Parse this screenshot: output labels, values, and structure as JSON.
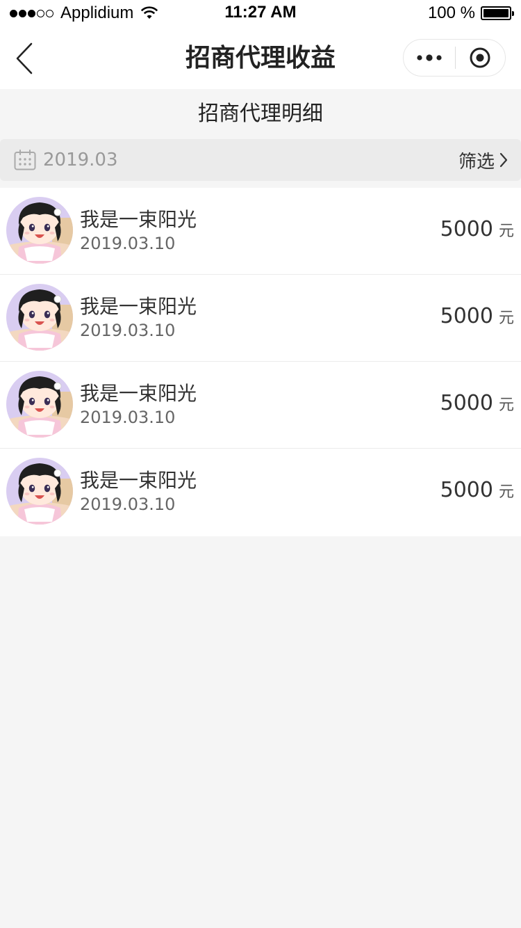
{
  "status_bar": {
    "carrier": "Applidium",
    "time": "11:27 AM",
    "battery": "100 %"
  },
  "nav": {
    "title": "招商代理收益"
  },
  "section": {
    "title": "招商代理明细"
  },
  "filter": {
    "date": "2019.03",
    "filter_label": "筛选"
  },
  "records": [
    {
      "name": "我是一束阳光",
      "date": "2019.03.10",
      "amount": "5000",
      "unit": "元"
    },
    {
      "name": "我是一束阳光",
      "date": "2019.03.10",
      "amount": "5000",
      "unit": "元"
    },
    {
      "name": "我是一束阳光",
      "date": "2019.03.10",
      "amount": "5000",
      "unit": "元"
    },
    {
      "name": "我是一束阳光",
      "date": "2019.03.10",
      "amount": "5000",
      "unit": "元"
    }
  ],
  "colors": {
    "background": "#f5f5f5",
    "filter_bar": "#ebebeb",
    "text_primary": "#333333",
    "text_secondary": "#999999"
  },
  "icons": [
    "signal-dots-icon",
    "wifi-icon",
    "battery-icon",
    "back-chevron-icon",
    "more-dots-icon",
    "close-target-icon",
    "calendar-icon",
    "chevron-right-icon",
    "avatar-image"
  ]
}
